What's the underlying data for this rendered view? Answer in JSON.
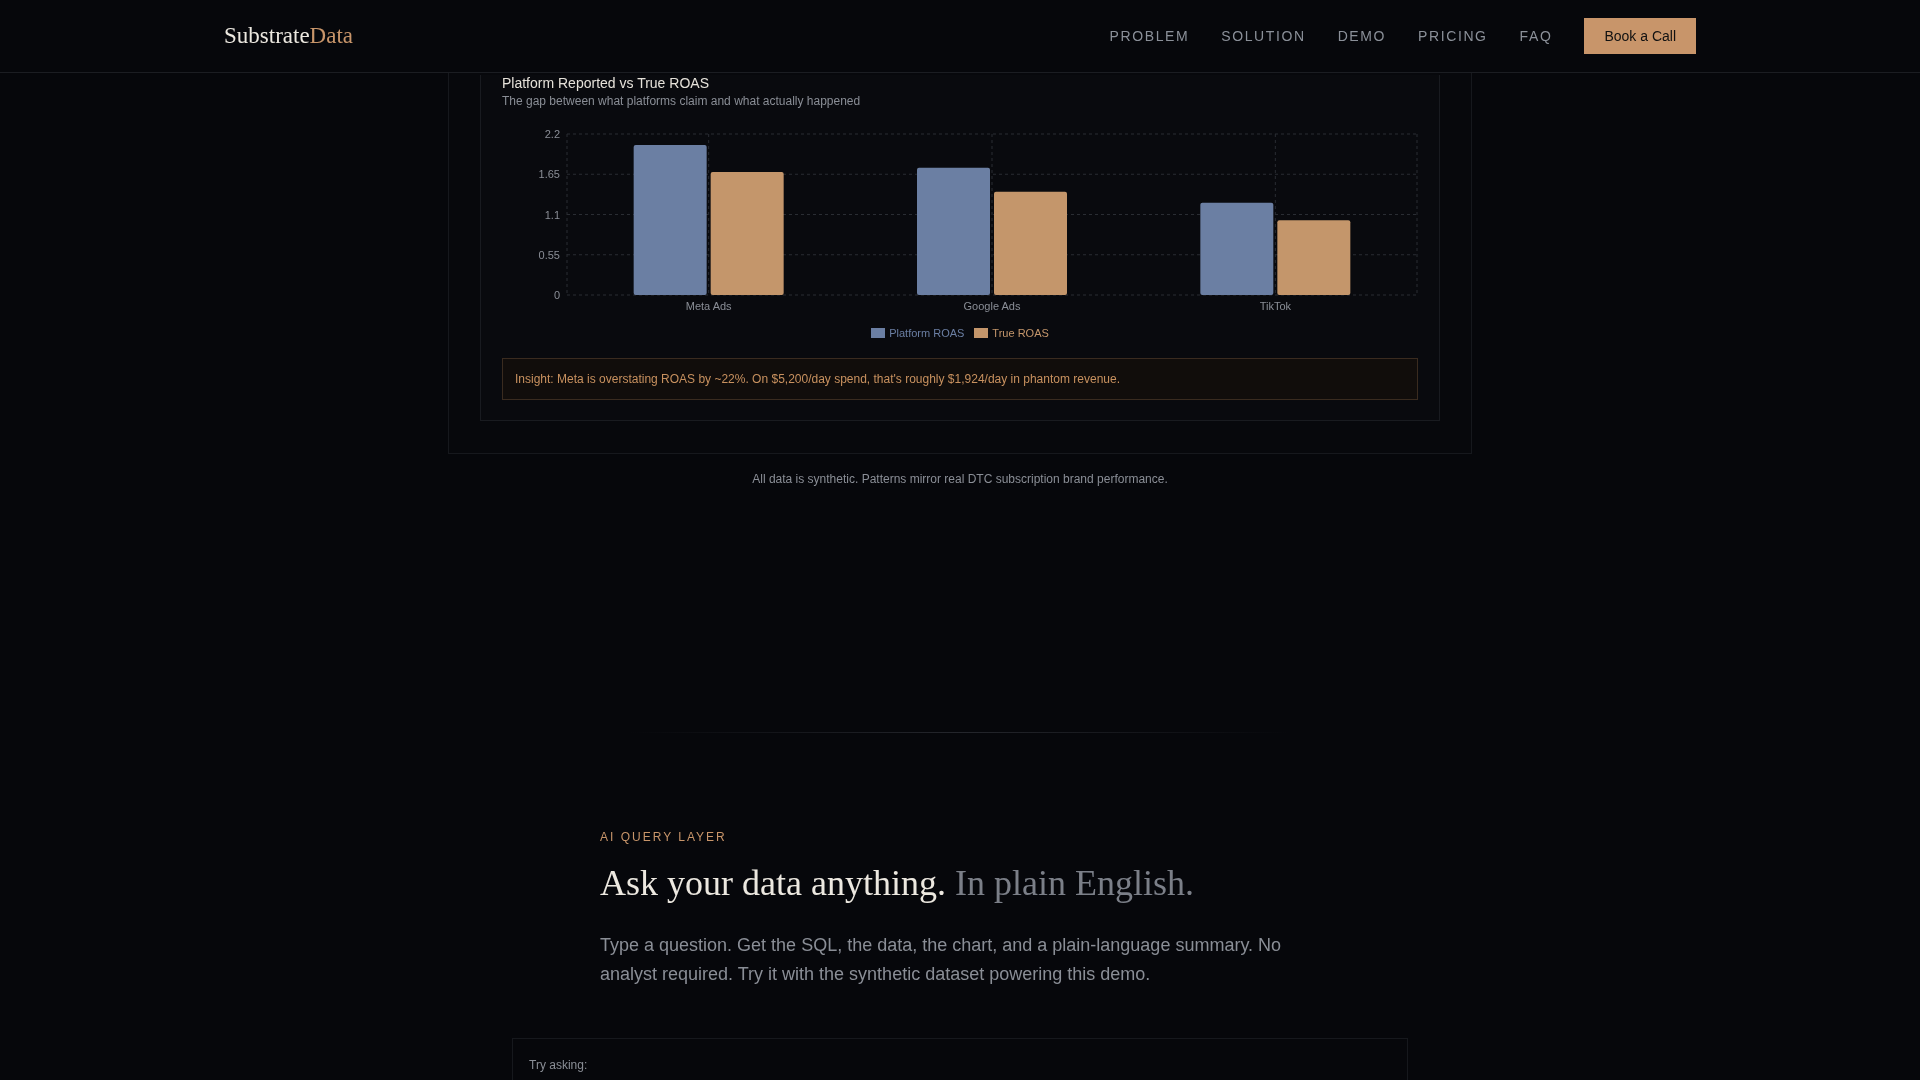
{
  "header": {
    "logo": {
      "main": "Substrate",
      "accent": "Data"
    },
    "nav_links": [
      "PROBLEM",
      "SOLUTION",
      "DEMO",
      "PRICING",
      "FAQ"
    ],
    "cta_button": "Book a Call"
  },
  "roas_panel": {
    "title": "Platform Reported vs True ROAS",
    "subtitle": "The gap between what platforms claim and what actually happened",
    "chart_data": {
      "type": "bar",
      "categories": [
        "Meta Ads",
        "Google Ads",
        "TikTok"
      ],
      "series": [
        {
          "name": "Platform ROAS",
          "color": "#6b7fa3",
          "values": [
            2.05,
            1.74,
            1.26
          ]
        },
        {
          "name": "True ROAS",
          "color": "#c4966b",
          "values": [
            1.68,
            1.41,
            1.02
          ]
        }
      ],
      "ylim": [
        0,
        2.2
      ],
      "yticks": [
        0,
        0.55,
        1.1,
        1.65,
        2.2
      ],
      "grid": true,
      "legend": "bottom"
    },
    "insight": "Insight: Meta is overstating ROAS by ~22%. On $5,200/day spend, that's roughly $1,924/day in phantom revenue."
  },
  "footnote": "All data is synthetic. Patterns mirror real DTC subscription brand performance.",
  "ai_section": {
    "eyebrow": "AI QUERY LAYER",
    "heading": "Ask your data anything.",
    "heading_muted": "In plain English.",
    "description": "Type a question. Get the SQL, the data, the chart, and a plain-language summary. No analyst required. Try it with the synthetic dataset powering this demo.",
    "prompt_card": {
      "label": "Try asking:"
    }
  }
}
